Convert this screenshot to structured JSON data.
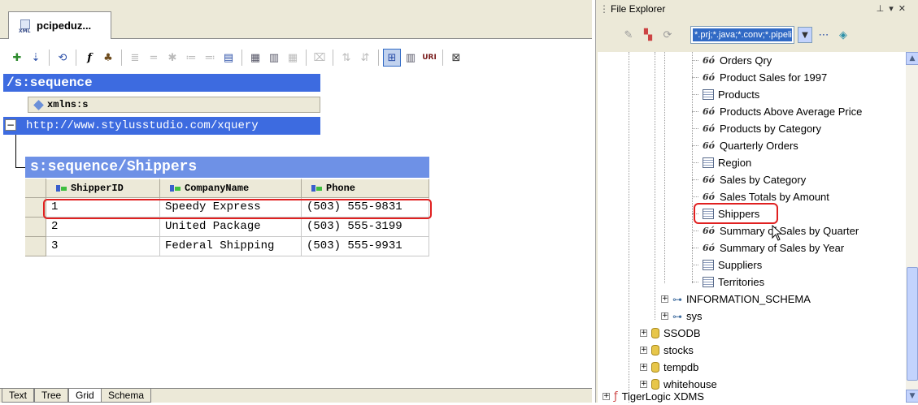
{
  "editor": {
    "doc_tab_label": "pcipeduz...",
    "doc_tab_icon_text": "XML",
    "root_element_header": "/s:sequence",
    "attribute_label": "xmlns:s",
    "attribute_value": "http://www.stylusstudio.com/xquery",
    "expander_symbol": "−",
    "child_element_header": "s:sequence/Shippers",
    "grid": {
      "columns": [
        "ShipperID",
        "CompanyName",
        "Phone"
      ],
      "rows": [
        [
          "1",
          "Speedy Express",
          "(503) 555-9831"
        ],
        [
          "2",
          "United Package",
          "(503) 555-3199"
        ],
        [
          "3",
          "Federal Shipping",
          "(503) 555-9931"
        ]
      ]
    },
    "highlighted_row_index": 0,
    "view_tabs": [
      "Text",
      "Tree",
      "Grid",
      "Schema"
    ],
    "active_view_tab": "Grid"
  },
  "file_explorer": {
    "title": "File Explorer",
    "filter_text": "*.prj;*.java;*.conv;*.pipeline;*.re",
    "tree": [
      {
        "label": "Orders Qry",
        "icon": "view-icon"
      },
      {
        "label": "Product Sales for 1997",
        "icon": "view-icon"
      },
      {
        "label": "Products",
        "icon": "table-icon"
      },
      {
        "label": "Products Above Average Price",
        "icon": "view-icon"
      },
      {
        "label": "Products by Category",
        "icon": "view-icon"
      },
      {
        "label": "Quarterly Orders",
        "icon": "view-icon"
      },
      {
        "label": "Region",
        "icon": "table-icon"
      },
      {
        "label": "Sales by Category",
        "icon": "view-icon"
      },
      {
        "label": "Sales Totals by Amount",
        "icon": "view-icon"
      },
      {
        "label": "Shippers",
        "icon": "table-icon",
        "selected": true
      },
      {
        "label": "Summary of Sales by Quarter",
        "icon": "view-icon"
      },
      {
        "label": "Summary of Sales by Year",
        "icon": "view-icon"
      },
      {
        "label": "Suppliers",
        "icon": "table-icon"
      },
      {
        "label": "Territories",
        "icon": "table-icon"
      },
      {
        "label": "INFORMATION_SCHEMA",
        "icon": "schema-icon"
      },
      {
        "label": "sys",
        "icon": "schema-icon"
      },
      {
        "label": "SSODB",
        "icon": "database-icon"
      },
      {
        "label": "stocks",
        "icon": "database-icon"
      },
      {
        "label": "tempdb",
        "icon": "database-icon"
      },
      {
        "label": "whitehouse",
        "icon": "database-icon"
      },
      {
        "label": "TigerLogic XDMS",
        "icon": "xdms-icon"
      }
    ]
  },
  "colors": {
    "element_header": "#3d6be0",
    "child_header": "#6e91e6",
    "highlight": "#e02020",
    "selection": "#316ac5"
  }
}
